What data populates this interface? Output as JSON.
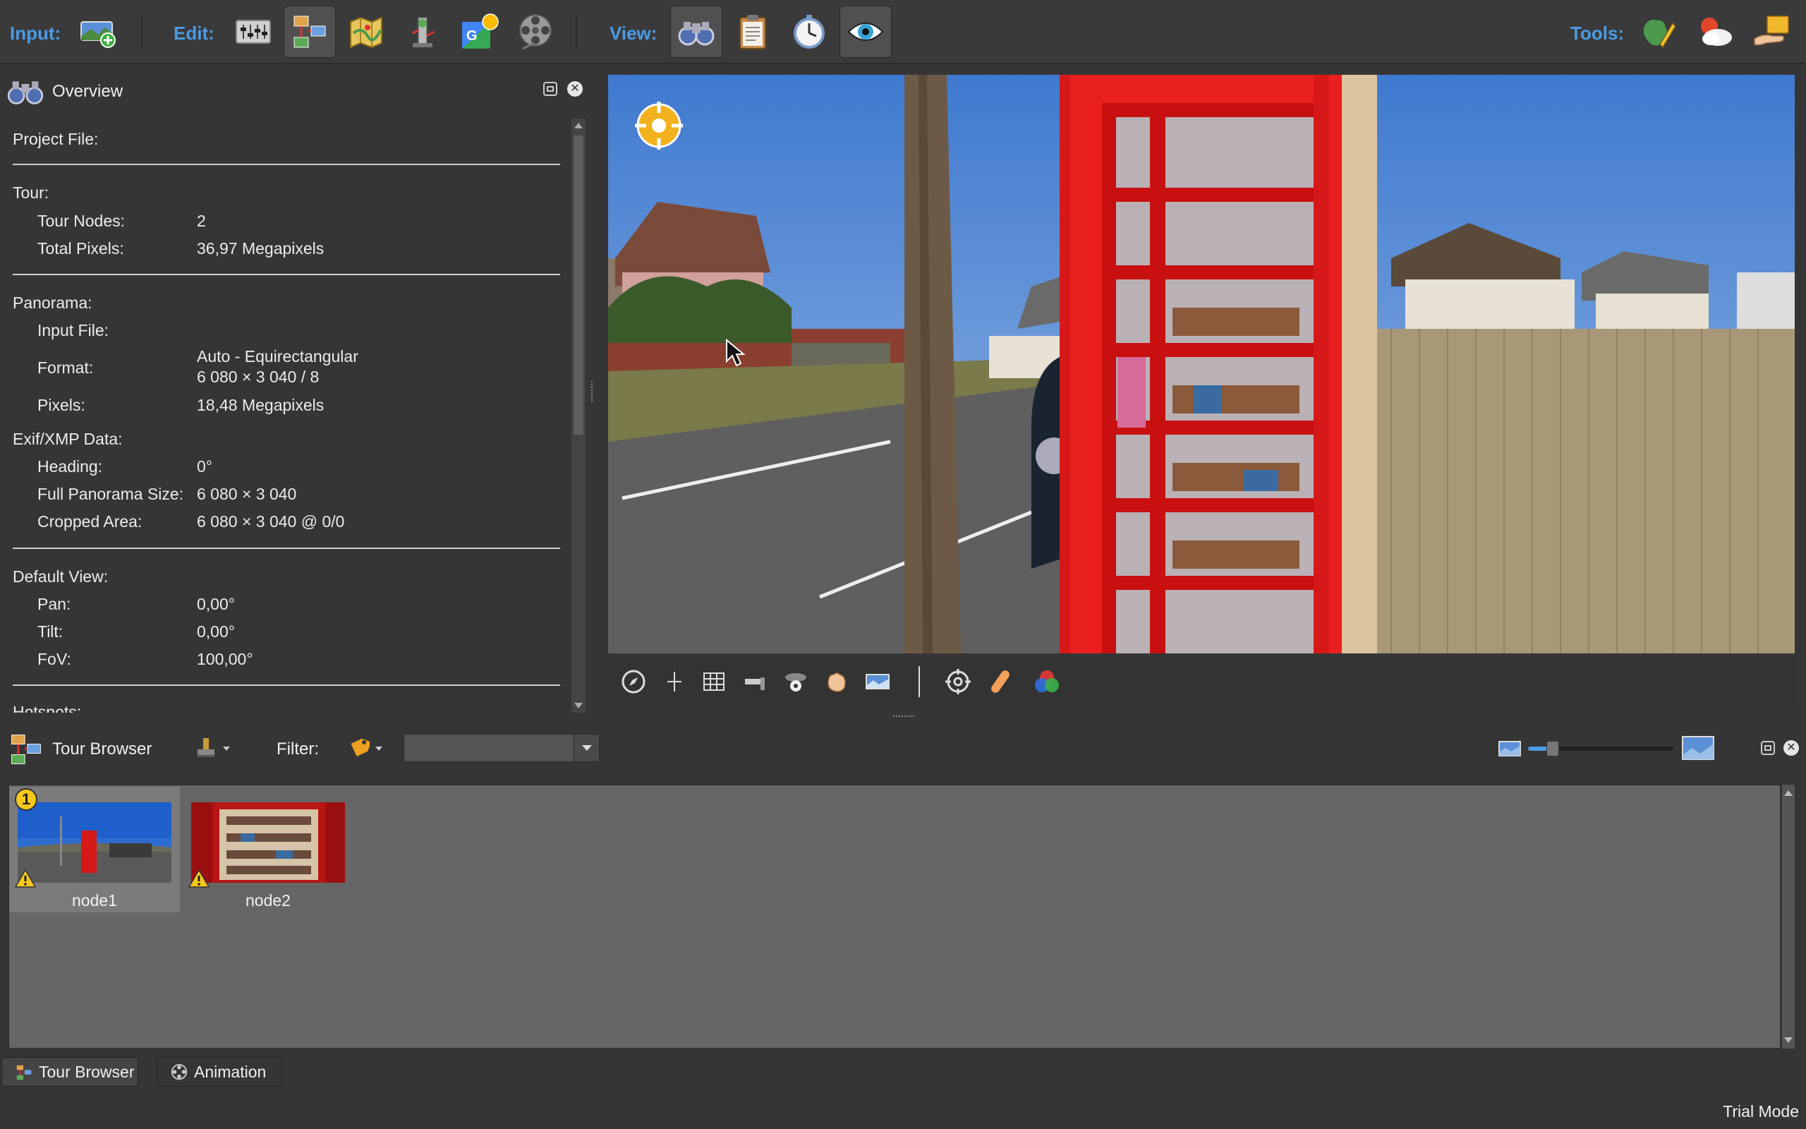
{
  "toolbar": {
    "input_label": "Input:",
    "edit_label": "Edit:",
    "view_label": "View:",
    "tools_label": "Tools:",
    "input_buttons": [
      "add-panorama-icon"
    ],
    "edit_buttons": [
      "adjustments-icon",
      "tour-editor-icon",
      "map-editor-icon",
      "hotspot-editor-icon",
      "google-maps-icon",
      "film-reel-icon"
    ],
    "view_buttons": [
      "binoculars-icon",
      "clipboard-icon",
      "stopwatch-icon",
      "eye-icon"
    ],
    "tools_buttons": [
      "map-pen-icon",
      "weather-icon",
      "share-hand-icon"
    ],
    "active_button": "tour-editor-icon",
    "accent_color": "#4a9be6"
  },
  "overview": {
    "title": "Overview",
    "project_file_label": "Project File:",
    "tour_label": "Tour:",
    "tour_nodes_label": "Tour Nodes:",
    "tour_nodes_value": "2",
    "total_pixels_label": "Total Pixels:",
    "total_pixels_value": "36,97 Megapixels",
    "panorama_label": "Panorama:",
    "input_file_label": "Input File:",
    "format_label": "Format:",
    "format_value_1": "Auto - Equirectangular",
    "format_value_2": "6 080 × 3 040 / 8",
    "pixels_label": "Pixels:",
    "pixels_value": "18,48 Megapixels",
    "exif_label": "Exif/XMP Data:",
    "heading_label": "Heading:",
    "heading_value": "0°",
    "full_size_label": "Full Panorama Size:",
    "full_size_value": "6 080 × 3 040",
    "cropped_label": "Cropped Area:",
    "cropped_value": "6 080 × 3 040 @ 0/0",
    "default_view_label": "Default View:",
    "pan_label": "Pan:",
    "pan_value": "0,00°",
    "tilt_label": "Tilt:",
    "tilt_value": "0,00°",
    "fov_label": "FoV:",
    "fov_value": "100,00°",
    "hotspots_label": "Hotspots:"
  },
  "viewer_tools": [
    "compass-icon",
    "crosshair-line-icon",
    "grid-icon",
    "level-icon",
    "nadir-icon",
    "hand-icon",
    "panorama-icon",
    "target-icon",
    "bandage-icon",
    "color-circles-icon"
  ],
  "tour_browser": {
    "title": "Tour Browser",
    "filter_label": "Filter:",
    "filter_value": "",
    "zoom_level": 0.05,
    "nodes": [
      {
        "label": "node1",
        "badge": "1",
        "selected": true
      },
      {
        "label": "node2",
        "badge": "",
        "selected": false
      }
    ]
  },
  "tabs": [
    "Tour Browser",
    "Animation"
  ],
  "active_tab": "Tour Browser",
  "status": "Trial Mode"
}
